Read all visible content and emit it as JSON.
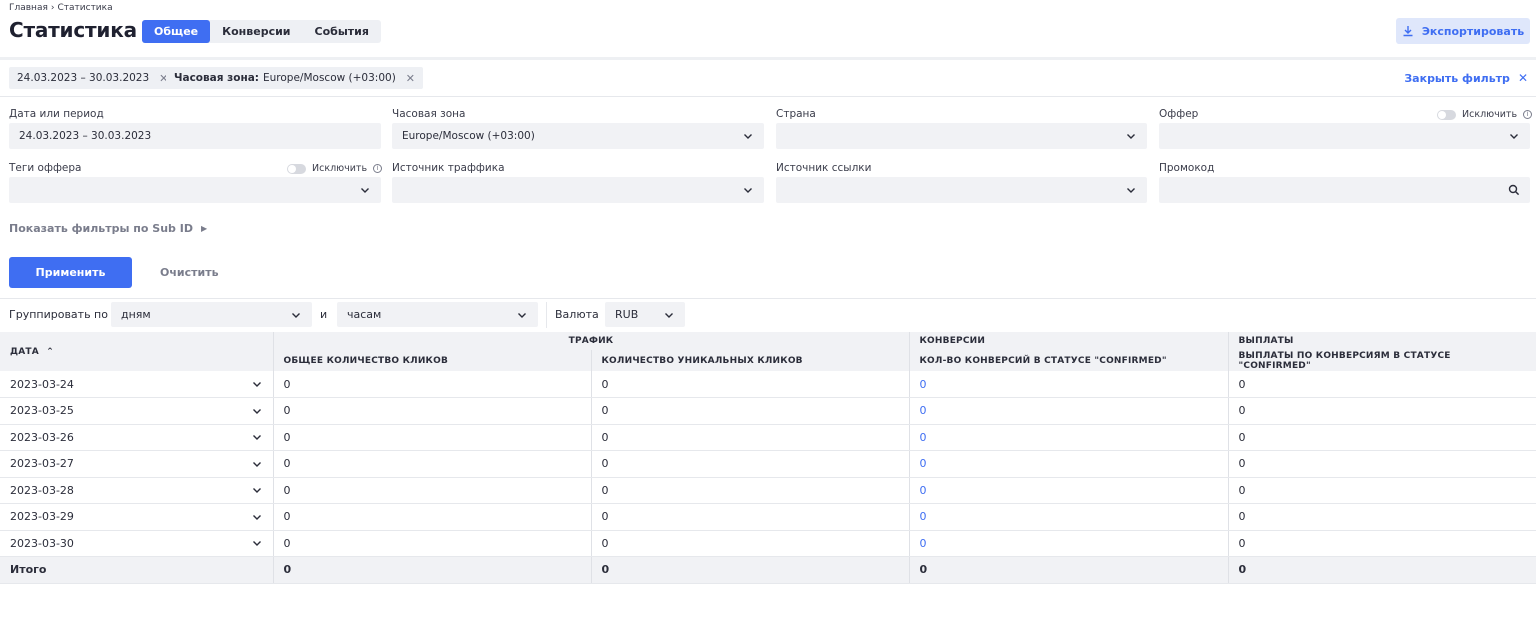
{
  "breadcrumbs": [
    "Главная",
    "Статистика"
  ],
  "page_title": "Статистика",
  "tabs": [
    {
      "label": "Общее",
      "active": true
    },
    {
      "label": "Конверсии",
      "active": false
    },
    {
      "label": "События",
      "active": false
    }
  ],
  "export_label": "Экспортировать",
  "chips": {
    "date_value": "24.03.2023 – 30.03.2023",
    "tz_label": "Часовая зона:",
    "tz_value": "Europe/Moscow (+03:00)"
  },
  "close_filter_label": "Закрыть фильтр",
  "filters": {
    "date_label": "Дата или период",
    "date_value": "24.03.2023 – 30.03.2023",
    "tz_label": "Часовая зона",
    "tz_value": "Europe/Moscow (+03:00)",
    "country_label": "Страна",
    "offer_label": "Оффер",
    "exclude_label": "Исключить",
    "offer_tags_label": "Теги оффера",
    "traffic_source_label": "Источник траффика",
    "link_source_label": "Источник ссылки",
    "promo_label": "Промокод"
  },
  "subid_label": "Показать фильтры по Sub ID",
  "apply_label": "Применить",
  "clear_label": "Очистить",
  "grouping": {
    "label": "Группировать по",
    "first": "дням",
    "and": "и",
    "second": "часам",
    "currency_label": "Валюта",
    "currency": "RUB"
  },
  "table": {
    "date_header": "ДАТА",
    "groups": {
      "traffic": "ТРАФИК",
      "conversions": "КОНВЕРСИИ",
      "payouts": "ВЫПЛАТЫ"
    },
    "columns": {
      "total_clicks": "ОБЩЕЕ КОЛИЧЕСТВО КЛИКОВ",
      "unique_clicks": "КОЛИЧЕСТВО УНИКАЛЬНЫХ КЛИКОВ",
      "conversions": "КОЛ-ВО КОНВЕРСИЙ В СТАТУСЕ \"CONFIRMED\"",
      "payouts": "ВЫПЛАТЫ ПО КОНВЕРСИЯМ В СТАТУСЕ \"CONFIRMED\""
    },
    "rows": [
      {
        "date": "2023-03-24",
        "total": "0",
        "unique": "0",
        "conv": "0",
        "pay": "0"
      },
      {
        "date": "2023-03-25",
        "total": "0",
        "unique": "0",
        "conv": "0",
        "pay": "0"
      },
      {
        "date": "2023-03-26",
        "total": "0",
        "unique": "0",
        "conv": "0",
        "pay": "0"
      },
      {
        "date": "2023-03-27",
        "total": "0",
        "unique": "0",
        "conv": "0",
        "pay": "0"
      },
      {
        "date": "2023-03-28",
        "total": "0",
        "unique": "0",
        "conv": "0",
        "pay": "0"
      },
      {
        "date": "2023-03-29",
        "total": "0",
        "unique": "0",
        "conv": "0",
        "pay": "0"
      },
      {
        "date": "2023-03-30",
        "total": "0",
        "unique": "0",
        "conv": "0",
        "pay": "0"
      }
    ],
    "total": {
      "label": "Итого",
      "total": "0",
      "unique": "0",
      "conv": "0",
      "pay": "0"
    }
  },
  "colors": {
    "accent": "#3f6ef2",
    "surface": "#f1f2f5"
  }
}
